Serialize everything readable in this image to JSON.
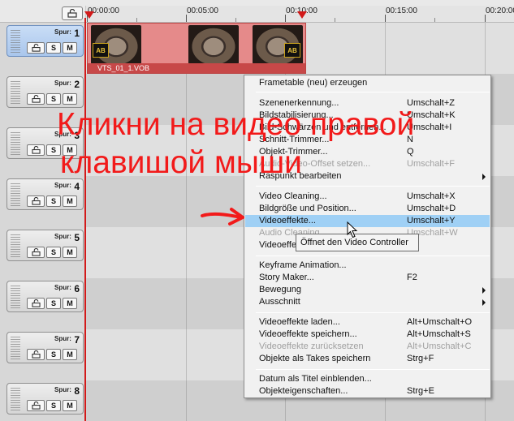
{
  "ruler": {
    "timecodes": [
      "00:00:00",
      "00:05:00",
      "00:10:00",
      "00:15:00",
      "00:20:00"
    ]
  },
  "track_header": {
    "spur_label": "Spur:",
    "lock_label": "",
    "solo_label": "S",
    "mute_label": "M"
  },
  "tracks": [
    "1",
    "2",
    "3",
    "4",
    "5",
    "6",
    "7",
    "8"
  ],
  "clip": {
    "name": "VTS_01_1.VOB",
    "badge": "AB"
  },
  "context_menu": {
    "items": [
      {
        "label": "Frametable (neu) erzeugen",
        "shortcut": ""
      },
      {
        "label": "Szenenerkennung...",
        "shortcut": "Umschalt+Z"
      },
      {
        "label": "Bildstabilisierung...",
        "shortcut": "Umschalt+K"
      },
      {
        "label": "Bild-Schwärzen und entfernen...",
        "shortcut": "Umschalt+I"
      },
      {
        "label": "Schnitt-Trimmer...",
        "shortcut": "N"
      },
      {
        "label": "Objekt-Trimmer...",
        "shortcut": "Q"
      },
      {
        "label": "Audio-Video-Offset setzen...",
        "shortcut": "Umschalt+F"
      },
      {
        "label": "Raspunkt bearbeiten",
        "shortcut": ""
      },
      {
        "label": "Video Cleaning...",
        "shortcut": "Umschalt+X"
      },
      {
        "label": "Bildgröße und Position...",
        "shortcut": "Umschalt+D"
      },
      {
        "label": "Videoeffekte...",
        "shortcut": "Umschalt+Y"
      },
      {
        "label": "Audio Cleaning...",
        "shortcut": "Umschalt+W"
      },
      {
        "label": "Videoeffekte",
        "shortcut": ""
      },
      {
        "label": "Keyframe Animation...",
        "shortcut": ""
      },
      {
        "label": "Story Maker...",
        "shortcut": "F2"
      },
      {
        "label": "Bewegung",
        "shortcut": ""
      },
      {
        "label": "Ausschnitt",
        "shortcut": ""
      },
      {
        "label": "Videoeffekte laden...",
        "shortcut": "Alt+Umschalt+O"
      },
      {
        "label": "Videoeffekte speichern...",
        "shortcut": "Alt+Umschalt+S"
      },
      {
        "label": "Videoeffekte zurücksetzen",
        "shortcut": "Alt+Umschalt+C"
      },
      {
        "label": "Objekte als Takes speichern",
        "shortcut": "Strg+F"
      },
      {
        "label": "Datum als Titel einblenden...",
        "shortcut": ""
      },
      {
        "label": "Objekteigenschaften...",
        "shortcut": "Strg+E"
      }
    ]
  },
  "tooltip": "Öffnet den Video Controller",
  "annotation": {
    "line1": "Кликни на видео правой",
    "line2": "клавишой мыши"
  },
  "colors": {
    "annotation": "#f21a1a",
    "highlight": "#9fd0f5",
    "clip": "#e58a8a",
    "playhead": "#d21a1a"
  }
}
